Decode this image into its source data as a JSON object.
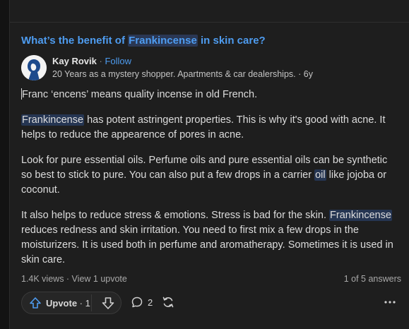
{
  "question": {
    "before": "What’s the benefit of ",
    "highlight": "Frankincense",
    "after": " in skin care?"
  },
  "author": {
    "name": "Kay Rovik",
    "separator": " · ",
    "follow_label": "Follow",
    "credential": "20 Years as a mystery shopper. Apartments & car dealerships. · 6y"
  },
  "answer": {
    "p1": "Franc ‘encens’ means quality incense in old French.",
    "p2_highlight": "Frankincense",
    "p2_rest": " has potent astringent properties. This is why it's good with acne. It helps to reduce the appearence of pores in acne.",
    "p3_before": "Look for pure essential oils. Perfume oils and pure essential oils can be synthetic so best to stick to pure. You can also put a few drops in a carrier ",
    "p3_link": "oil",
    "p3_after": " like jojoba or coconut.",
    "p4_before": "It also helps to reduce stress & emotions. Stress is bad for the skin. ",
    "p4_highlight": "Frankincense",
    "p4_after": " reduces redness and skin irritation. You need to first mix a few drops in the moisturizers. It is used both in perfume and aromatherapy. Sometimes it is used in skin care."
  },
  "stats": {
    "text": "1.4K views · View 1 upvote",
    "counter": "1 of 5 answers"
  },
  "actions": {
    "upvote_label": "Upvote",
    "upvote_count": " · 1",
    "comment_count": "2"
  },
  "icons": {
    "upvote": "upvote-arrow-icon",
    "downvote": "downvote-arrow-icon",
    "comment": "comment-icon",
    "share": "share-icon",
    "more": "more-icon"
  },
  "colors": {
    "background": "#131313",
    "card": "#1e1e1e",
    "accent": "#4e9cf0",
    "highlight": "#2a3753",
    "text": "#dcdcdc"
  }
}
